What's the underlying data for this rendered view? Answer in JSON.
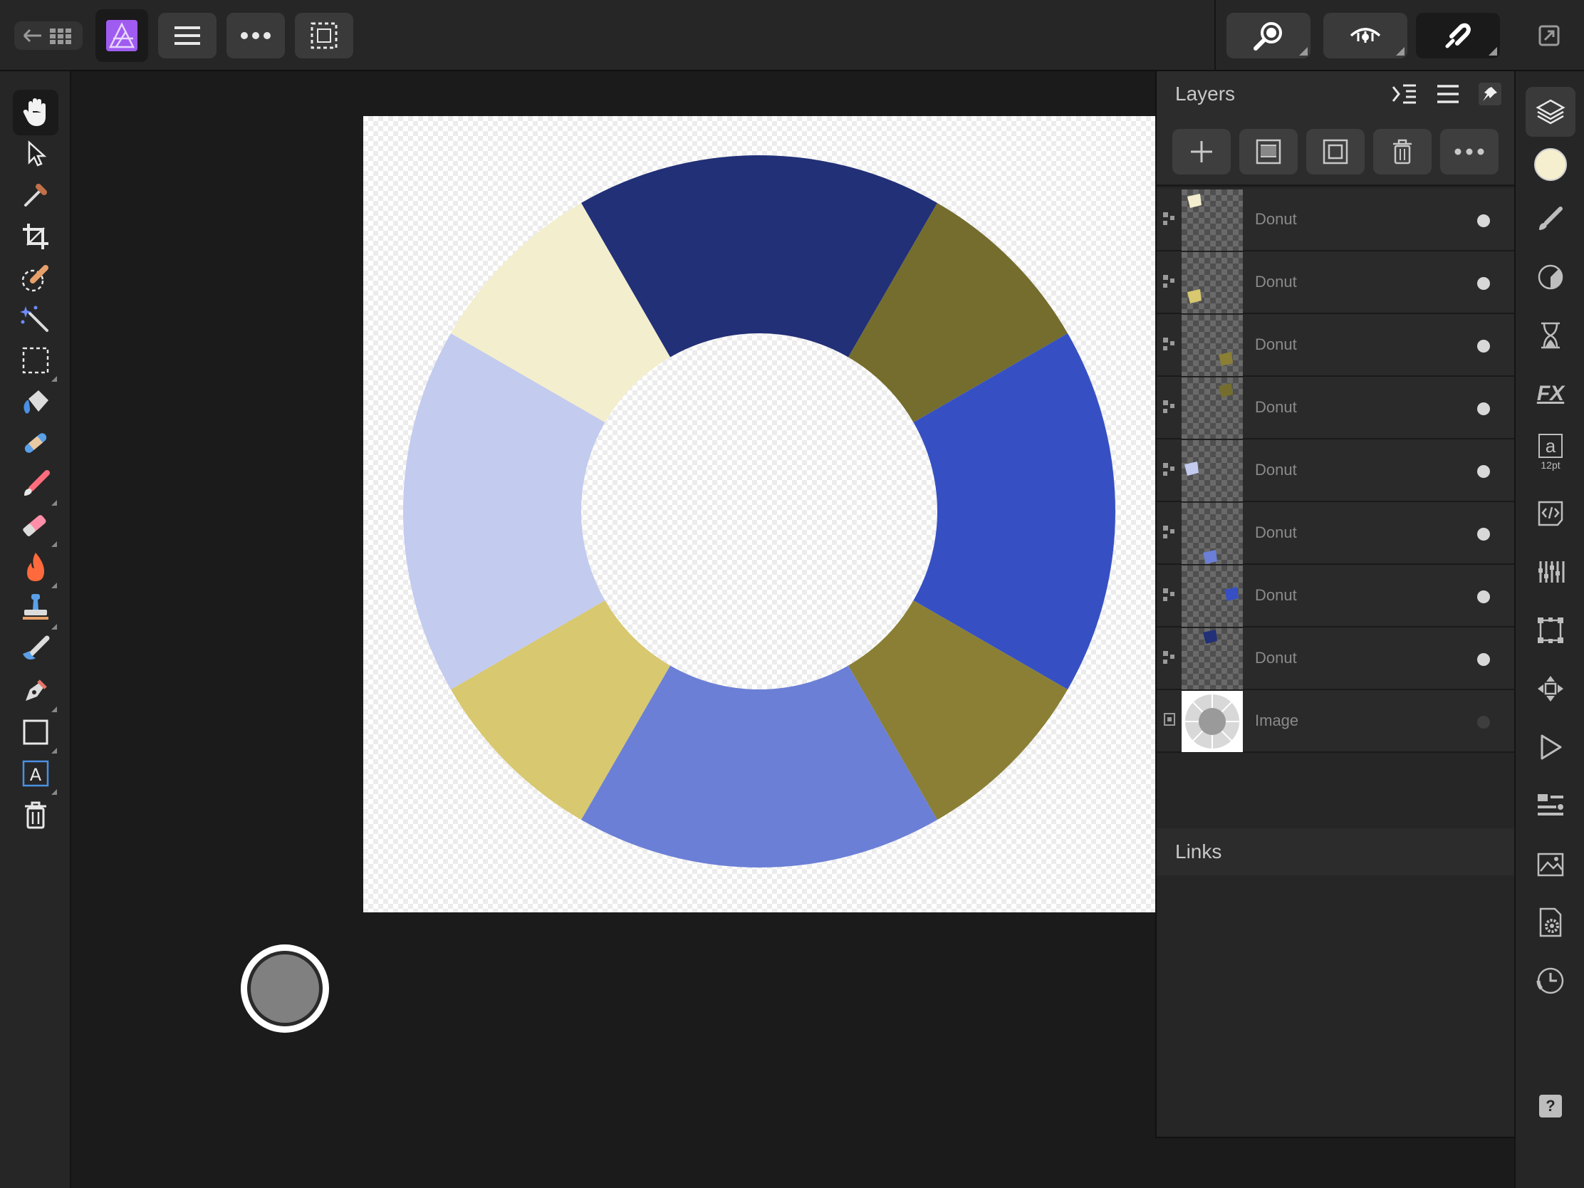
{
  "app": {
    "name": "Affinity Photo",
    "colors": {
      "background": "#1b1b1b",
      "panel": "#262626",
      "accent": "#a05cf0",
      "foreground_swatch": "#f5efd0"
    }
  },
  "topbar": {
    "items": [
      {
        "name": "back-to-gallery-button",
        "icon": "arrow-grid-icon"
      },
      {
        "name": "photo-persona-button",
        "icon": "affinity-photo-logo"
      },
      {
        "name": "document-menu-button",
        "icon": "hamburger-icon"
      },
      {
        "name": "more-menu-button",
        "icon": "ellipsis-icon"
      },
      {
        "name": "selection-button",
        "icon": "dashed-rect-icon"
      },
      {
        "name": "zoom-button",
        "icon": "magnifier-icon"
      },
      {
        "name": "view-mode-button",
        "icon": "eye-icon"
      },
      {
        "name": "snapping-button",
        "icon": "magnet-icon"
      },
      {
        "name": "fullscreen-button",
        "icon": "fullscreen-icon"
      }
    ]
  },
  "left_tools": [
    {
      "name": "view-tool",
      "icon": "hand-icon",
      "active": true
    },
    {
      "name": "move-tool",
      "icon": "pointer-icon"
    },
    {
      "name": "color-picker-tool",
      "icon": "eyedropper-icon"
    },
    {
      "name": "crop-tool",
      "icon": "crop-icon"
    },
    {
      "name": "selection-brush-tool",
      "icon": "selection-brush-icon"
    },
    {
      "name": "flood-select-tool",
      "icon": "magic-wand-icon"
    },
    {
      "name": "marquee-tool",
      "icon": "marquee-icon"
    },
    {
      "name": "flood-fill-tool",
      "icon": "paint-bucket-icon"
    },
    {
      "name": "healing-tool",
      "icon": "bandage-icon"
    },
    {
      "name": "paint-brush-tool",
      "icon": "paintbrush-icon"
    },
    {
      "name": "erase-brush-tool",
      "icon": "eraser-icon"
    },
    {
      "name": "dodge-burn-tool",
      "icon": "flame-icon"
    },
    {
      "name": "clone-tool",
      "icon": "stamp-icon"
    },
    {
      "name": "smudge-tool",
      "icon": "smudge-icon"
    },
    {
      "name": "pen-tool",
      "icon": "pen-nib-icon"
    },
    {
      "name": "shape-tool",
      "icon": "rectangle-icon"
    },
    {
      "name": "text-tool",
      "icon": "text-frame-icon"
    },
    {
      "name": "delete-tool",
      "icon": "trash-icon"
    }
  ],
  "right_studio": [
    {
      "name": "layers-studio",
      "icon": "layers-icon",
      "active": true
    },
    {
      "name": "color-studio",
      "icon": "color-swatch-icon"
    },
    {
      "name": "brushes-studio",
      "icon": "brush-icon"
    },
    {
      "name": "adjustments-studio",
      "icon": "adjustment-dial-icon"
    },
    {
      "name": "history-studio",
      "icon": "hourglass-icon"
    },
    {
      "name": "effects-studio",
      "icon": "fx-icon",
      "label": "FX"
    },
    {
      "name": "text-studio",
      "icon": "text-style-icon",
      "label": "a",
      "sublabel": "12pt"
    },
    {
      "name": "macro-studio",
      "icon": "code-icon"
    },
    {
      "name": "channels-studio",
      "icon": "channels-icon"
    },
    {
      "name": "transform-studio",
      "icon": "transform-icon"
    },
    {
      "name": "navigator-studio",
      "icon": "move-arrows-icon"
    },
    {
      "name": "play-studio",
      "icon": "play-icon"
    },
    {
      "name": "info-studio",
      "icon": "info-list-icon"
    },
    {
      "name": "stock-studio",
      "icon": "image-stack-icon"
    },
    {
      "name": "document-settings-studio",
      "icon": "doc-gear-icon"
    },
    {
      "name": "history-clock-studio",
      "icon": "clock-icon"
    },
    {
      "name": "help-button",
      "icon": "help-icon",
      "label": "?"
    }
  ],
  "layers_panel": {
    "title": "Layers",
    "toolbar": [
      {
        "name": "add-layer-button",
        "icon": "plus-icon"
      },
      {
        "name": "add-mask-button",
        "icon": "mask-icon"
      },
      {
        "name": "group-layers-button",
        "icon": "group-icon"
      },
      {
        "name": "delete-layer-button",
        "icon": "trash-icon"
      },
      {
        "name": "layer-options-button",
        "icon": "ellipsis-icon"
      }
    ],
    "layers": [
      {
        "name": "Donut",
        "type": "curves",
        "color": "#f3eecd",
        "visible": true
      },
      {
        "name": "Donut",
        "type": "curves",
        "color": "#d8c86f",
        "visible": true
      },
      {
        "name": "Donut",
        "type": "curves",
        "color": "#8a7f35",
        "visible": true
      },
      {
        "name": "Donut",
        "type": "curves",
        "color": "#756d2d",
        "visible": true
      },
      {
        "name": "Donut",
        "type": "curves",
        "color": "#c3cbee",
        "visible": true
      },
      {
        "name": "Donut",
        "type": "curves",
        "color": "#6b7fd6",
        "visible": true
      },
      {
        "name": "Donut",
        "type": "curves",
        "color": "#3650c3",
        "visible": true
      },
      {
        "name": "Donut",
        "type": "curves",
        "color": "#223077",
        "visible": true
      },
      {
        "name": "Image",
        "type": "image",
        "color": "#bdbdbd",
        "visible": false
      }
    ],
    "links_title": "Links"
  },
  "donut": {
    "segments": [
      {
        "color": "#223077",
        "start": -30,
        "end": 30
      },
      {
        "color": "#756d2d",
        "start": 30,
        "end": 60
      },
      {
        "color": "#3650c3",
        "start": 60,
        "end": 120
      },
      {
        "color": "#8a7f35",
        "start": 120,
        "end": 150
      },
      {
        "color": "#6b7fd6",
        "start": 150,
        "end": 210
      },
      {
        "color": "#d8c86f",
        "start": 210,
        "end": 240
      },
      {
        "color": "#c3cbee",
        "start": 240,
        "end": 300
      },
      {
        "color": "#f3eecd",
        "start": 300,
        "end": 330
      }
    ]
  }
}
